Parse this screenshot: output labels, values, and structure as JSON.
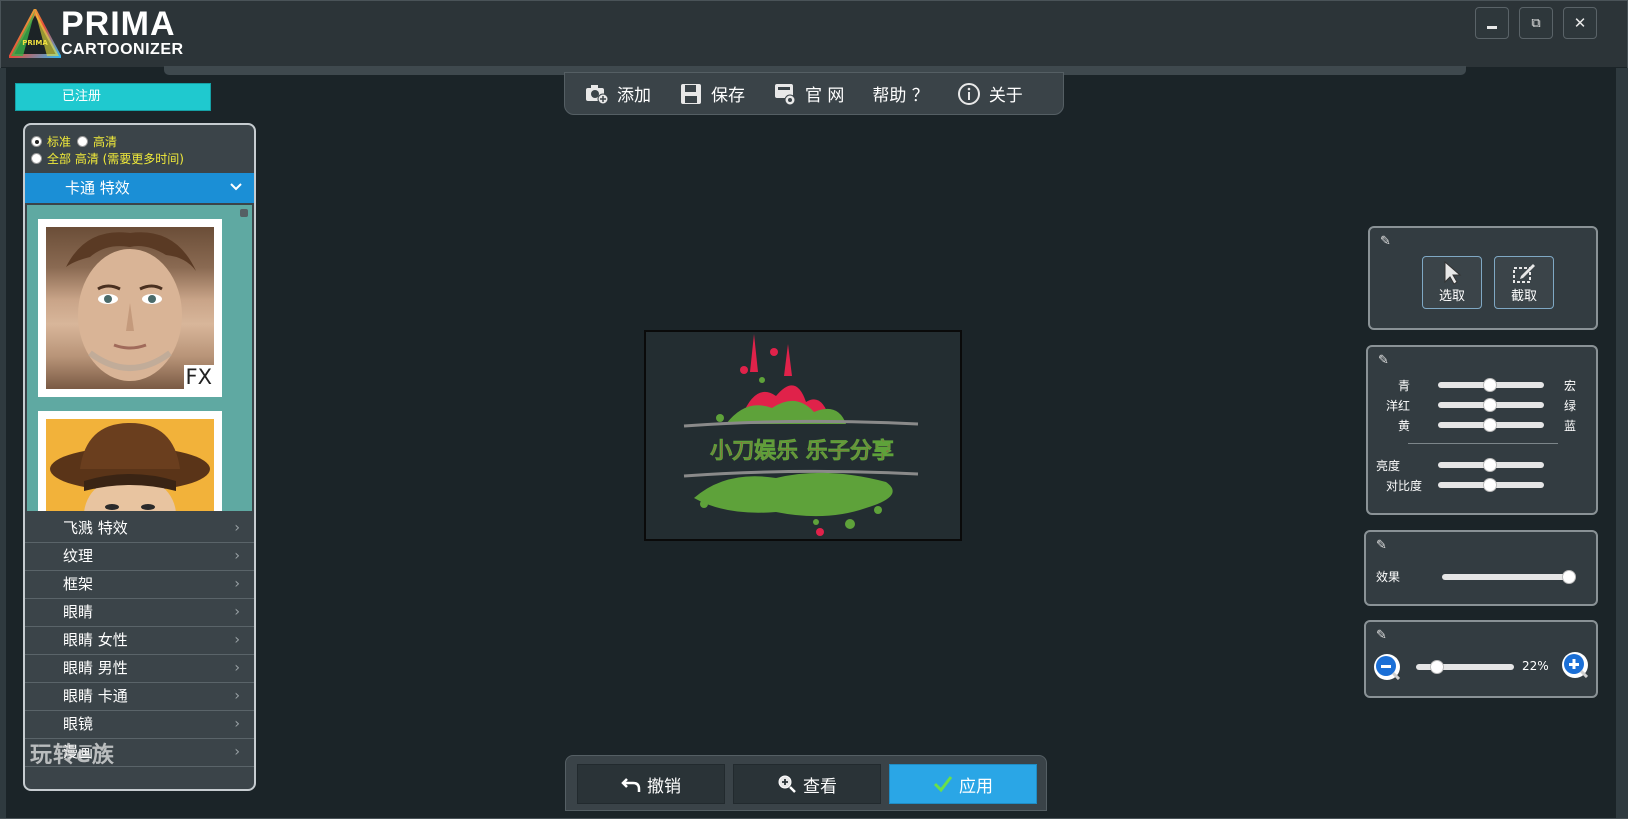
{
  "app": {
    "logo_small": "PRIMA",
    "logo_title": "PRIMA",
    "logo_subtitle": "CARTOONIZER"
  },
  "window": {
    "minimize_icon": "minimize-icon",
    "restore_icon": "restore-icon",
    "close_icon": "close-icon"
  },
  "toolbar": {
    "add": "添加",
    "save": "保存",
    "website": "官 网",
    "help": "帮助 ？",
    "about": "关于"
  },
  "left": {
    "registered": "已注册",
    "quality_standard": "标准",
    "quality_hd": "高清",
    "quality_all_hd": "全部 高清 (需要更多时间)",
    "active_category": "卡通 特效",
    "thumb_badge": "FX",
    "categories": [
      "飞溅 特效",
      "纹理",
      "框架",
      "眼睛",
      "眼睛 女性",
      "眼睛 男性",
      "眼睛 卡通",
      "眼镜",
      "漫画"
    ],
    "watermark": "玩转e族"
  },
  "canvas": {
    "image_text": "小刀娱乐 乐子分享"
  },
  "tools": {
    "select": "选取",
    "crop": "截取"
  },
  "color_panel": {
    "cyan": "青",
    "red": "宏",
    "magenta": "洋红",
    "green": "绿",
    "yellow": "黄",
    "blue": "蓝",
    "brightness": "亮度",
    "contrast": "对比度",
    "levels": {
      "cyan_red": 0.5,
      "magenta_green": 0.5,
      "yellow_blue": 0.5,
      "brightness": 0.5,
      "contrast": 0.5
    }
  },
  "effect_panel": {
    "label": "效果",
    "level": 1.0
  },
  "zoom_panel": {
    "zoom_text": "22%",
    "level": 0.2
  },
  "bottom": {
    "undo": "撤销",
    "view": "查看",
    "apply": "应用"
  },
  "colors": {
    "accent_cyan": "#1fc9cf",
    "accent_blue": "#1b8fd6",
    "apply_blue": "#2aa6e6",
    "background": "#1b2428"
  }
}
